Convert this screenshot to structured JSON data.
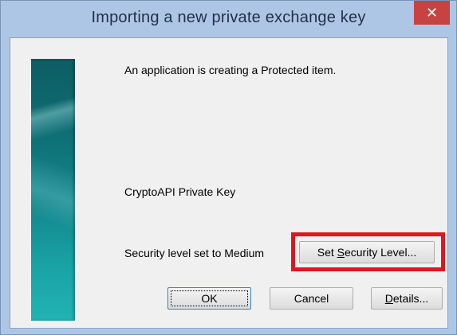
{
  "window": {
    "title": "Importing a new private exchange key",
    "close_icon": "close-icon"
  },
  "body": {
    "message": "An application is creating a Protected item.",
    "key_name": "CryptoAPI Private Key",
    "security_level_text": "Security level set to Medium"
  },
  "buttons": {
    "set_security_level": {
      "pre": "Set ",
      "accel": "S",
      "post": "ecurity Level..."
    },
    "ok": "OK",
    "cancel": "Cancel",
    "details": {
      "accel": "D",
      "post": "etails..."
    }
  },
  "colors": {
    "highlight": "#e0161e",
    "titlebar": "#aec6e6",
    "close_button": "#c74341"
  }
}
